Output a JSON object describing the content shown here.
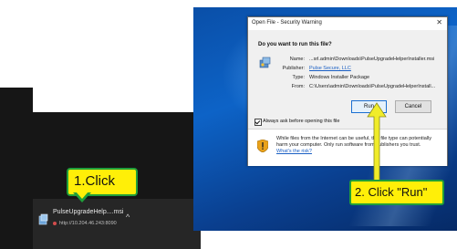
{
  "dialog": {
    "title": "Open File - Security Warning",
    "close_symbol": "✕",
    "question": "Do you want to run this file?",
    "fields": [
      {
        "label": "Name:",
        "value": "...srl.admin\\Downloads\\PulseUpgradeHelperInstaller.msi",
        "is_link": false
      },
      {
        "label": "Publisher:",
        "value": "Pulse Secure, LLC",
        "is_link": true
      },
      {
        "label": "Type:",
        "value": "Windows Installer Package",
        "is_link": false
      },
      {
        "label": "From:",
        "value": "C:\\Users\\admin\\Downloads\\PulseUpgradeHelperInstall...",
        "is_link": false
      }
    ],
    "run_label": "Run",
    "cancel_label": "Cancel",
    "checkbox_label": "Always ask before opening this file",
    "checkbox_checked": true,
    "warning_text": "While files from the Internet can be useful, this file type can potentially harm your computer. Only run software from publishers you trust.",
    "warning_link": "What's the risk?"
  },
  "download": {
    "file_name": "PulseUpgradeHelp....msi",
    "url": "http://10.204.46.243:8090",
    "caret": "^"
  },
  "callouts": {
    "step1": "1.Click",
    "step2": "2. Click \"Run\""
  },
  "colors": {
    "callout_fill": "#ffef08",
    "callout_border": "#1f9e3a",
    "arrow": "#f0ec2a",
    "run_button_border": "#1a6fd1",
    "desktop_blue": "#0d63c7"
  },
  "icons": [
    "installer-package-icon",
    "shield-warning-icon",
    "msi-file-icon",
    "close-icon",
    "chevron-up-icon"
  ]
}
